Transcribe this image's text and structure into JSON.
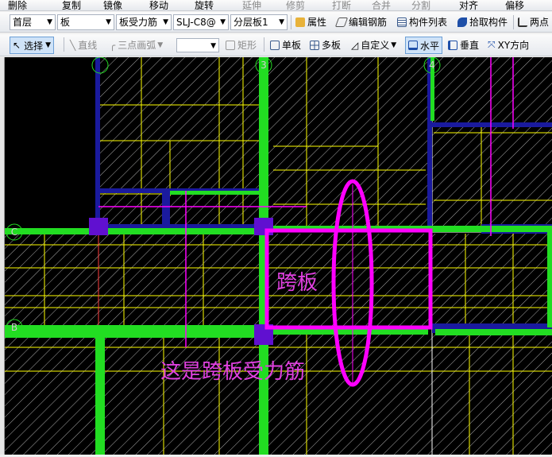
{
  "toolbar0": {
    "items": [
      "删除",
      "复制",
      "镜像",
      "移动",
      "旋转",
      "延伸",
      "修剪",
      "打断",
      "合并",
      "分割",
      "对齐",
      "偏移"
    ]
  },
  "toolbar1": {
    "floor": "首层",
    "category": "板",
    "component_type": "板受力筋",
    "rebar_name": "SLJ-C8@",
    "layer": "分层板1",
    "properties": "属性",
    "edit_rebar": "编辑钢筋",
    "component_list": "构件列表",
    "pick_component": "拾取构件",
    "two_point": "两点"
  },
  "toolbar2": {
    "select": "选择",
    "line": "直线",
    "arc": "三点画弧",
    "rect": "矩形",
    "single_slab": "单板",
    "multi_slab": "多板",
    "custom": "自定义",
    "horizontal": "水平",
    "vertical": "垂直",
    "xy_direction": "XY方向"
  },
  "canvas": {
    "axis_labels": [
      "C",
      "B",
      "3",
      "4"
    ],
    "annotation_span": "跨板",
    "annotation_note": "这是跨板受力筋"
  },
  "colors": {
    "beam": "#22dd22",
    "rebar": "#ff00ff",
    "grid": "#ffff00",
    "wall": "#1a1a9e",
    "hatch": "#aaaaaa"
  }
}
